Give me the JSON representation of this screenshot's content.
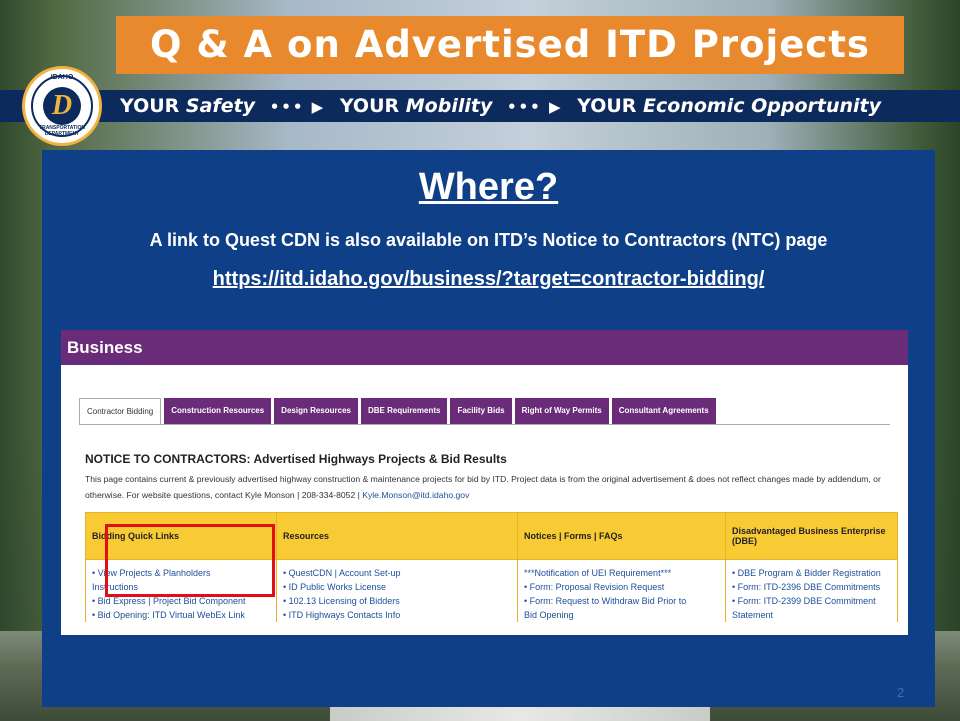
{
  "slide": {
    "title": "Q & A on Advertised ITD Projects",
    "tagline": {
      "p1": "YOUR",
      "w1": "Safety",
      "p2": "YOUR",
      "w2": "Mobility",
      "p3": "YOUR",
      "w3": "Economic Opportunity",
      "arrow": "••• ▶"
    },
    "seal": {
      "top": "IDAHO",
      "bottom": "TRANSPORTATION DEPARTMENT",
      "letter": "D"
    },
    "heading": "Where?",
    "intro": "A link to Quest CDN is also available on ITD’s Notice to Contractors (NTC) page",
    "url": "https://itd.idaho.gov/business/?target=contractor-bidding/",
    "page_number": "2"
  },
  "screenshot": {
    "header": "Business",
    "tabs": [
      "Contractor Bidding",
      "Construction Resources",
      "Design Resources",
      "DBE Requirements",
      "Facility Bids",
      "Right of Way Permits",
      "Consultant Agreements"
    ],
    "notice_title": "NOTICE TO CONTRACTORS: Advertised Highways Projects & Bid Results",
    "notice_desc": "This page contains current & previously advertised highway construction & maintenance projects for bid by ITD. Project data is from the original advertisement & does not reflect changes made by addendum, or otherwise. For website questions, contact Kyle Monson | 208-334-8052 |",
    "notice_email": "Kyle.Monson@itd.idaho.gov",
    "columns": [
      "Bidding Quick Links",
      "Resources",
      "Notices | Forms | FAQs",
      "Disadvantaged Business Enterprise (DBE)"
    ],
    "col1": [
      "• View Projects & Planholders",
      "Instructions",
      "• Bid Express | Project Bid Component",
      "• Bid Opening: ITD Virtual WebEx Link"
    ],
    "col2": [
      "• QuestCDN | Account Set-up",
      "• ID Public Works License",
      "• 102.13 Licensing of Bidders",
      "• ITD Highways Contacts Info"
    ],
    "col3": [
      "***Notification of UEI Requirement***",
      "• Form: Proposal Revision Request",
      "• Form: Request to Withdraw Bid Prior to",
      "Bid Opening"
    ],
    "col4": [
      "• DBE Program & Bidder Registration",
      "• Form: ITD-2396 DBE Commitments",
      "• Form: ITD-2399 DBE Commitment",
      "Statement"
    ]
  },
  "colors": {
    "banner": "#e8892e",
    "navy": "#0d2a5c",
    "panel": "#0f3f86",
    "purple": "#6a2c78",
    "yellow": "#f8ca33",
    "highlight_red": "#e30d18"
  }
}
